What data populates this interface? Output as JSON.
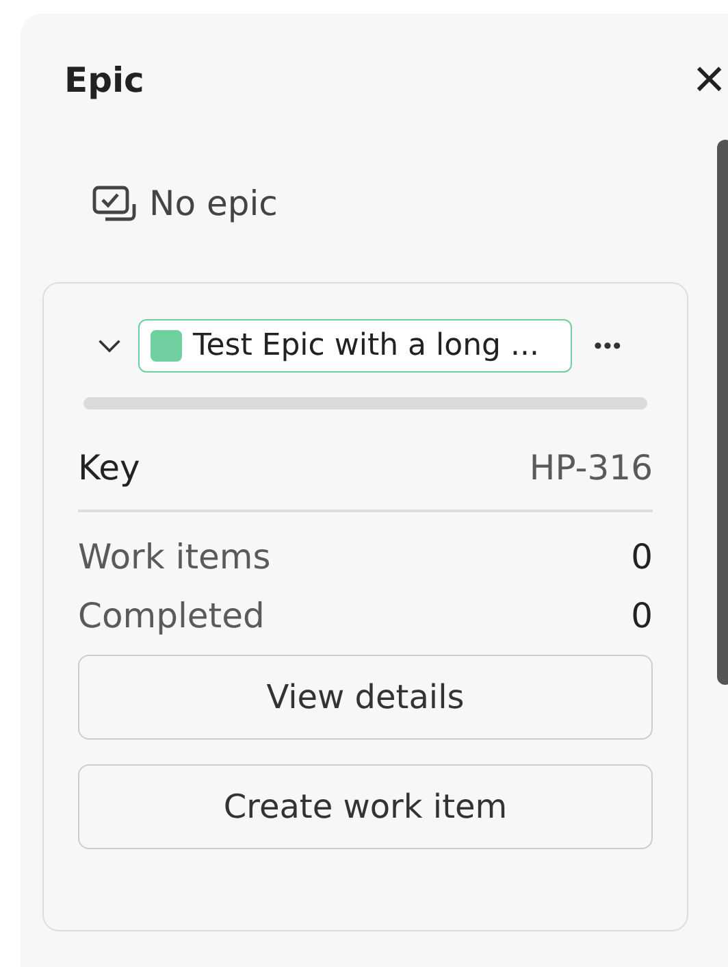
{
  "panel": {
    "title": "Epic",
    "close_label": "×"
  },
  "no_epic": {
    "label": "No epic"
  },
  "epic_card": {
    "expanded": true,
    "tag": {
      "label": "Test Epic with a long ...",
      "color": "#6fcf9f"
    },
    "more_label": "•••",
    "progress": {
      "level": 0
    },
    "key": {
      "label": "Key",
      "value": "HP-316"
    },
    "stats": [
      {
        "label": "Work items",
        "value": "0"
      },
      {
        "label": "Completed",
        "value": "0"
      }
    ],
    "buttons": [
      "View details",
      "Create work item"
    ]
  }
}
